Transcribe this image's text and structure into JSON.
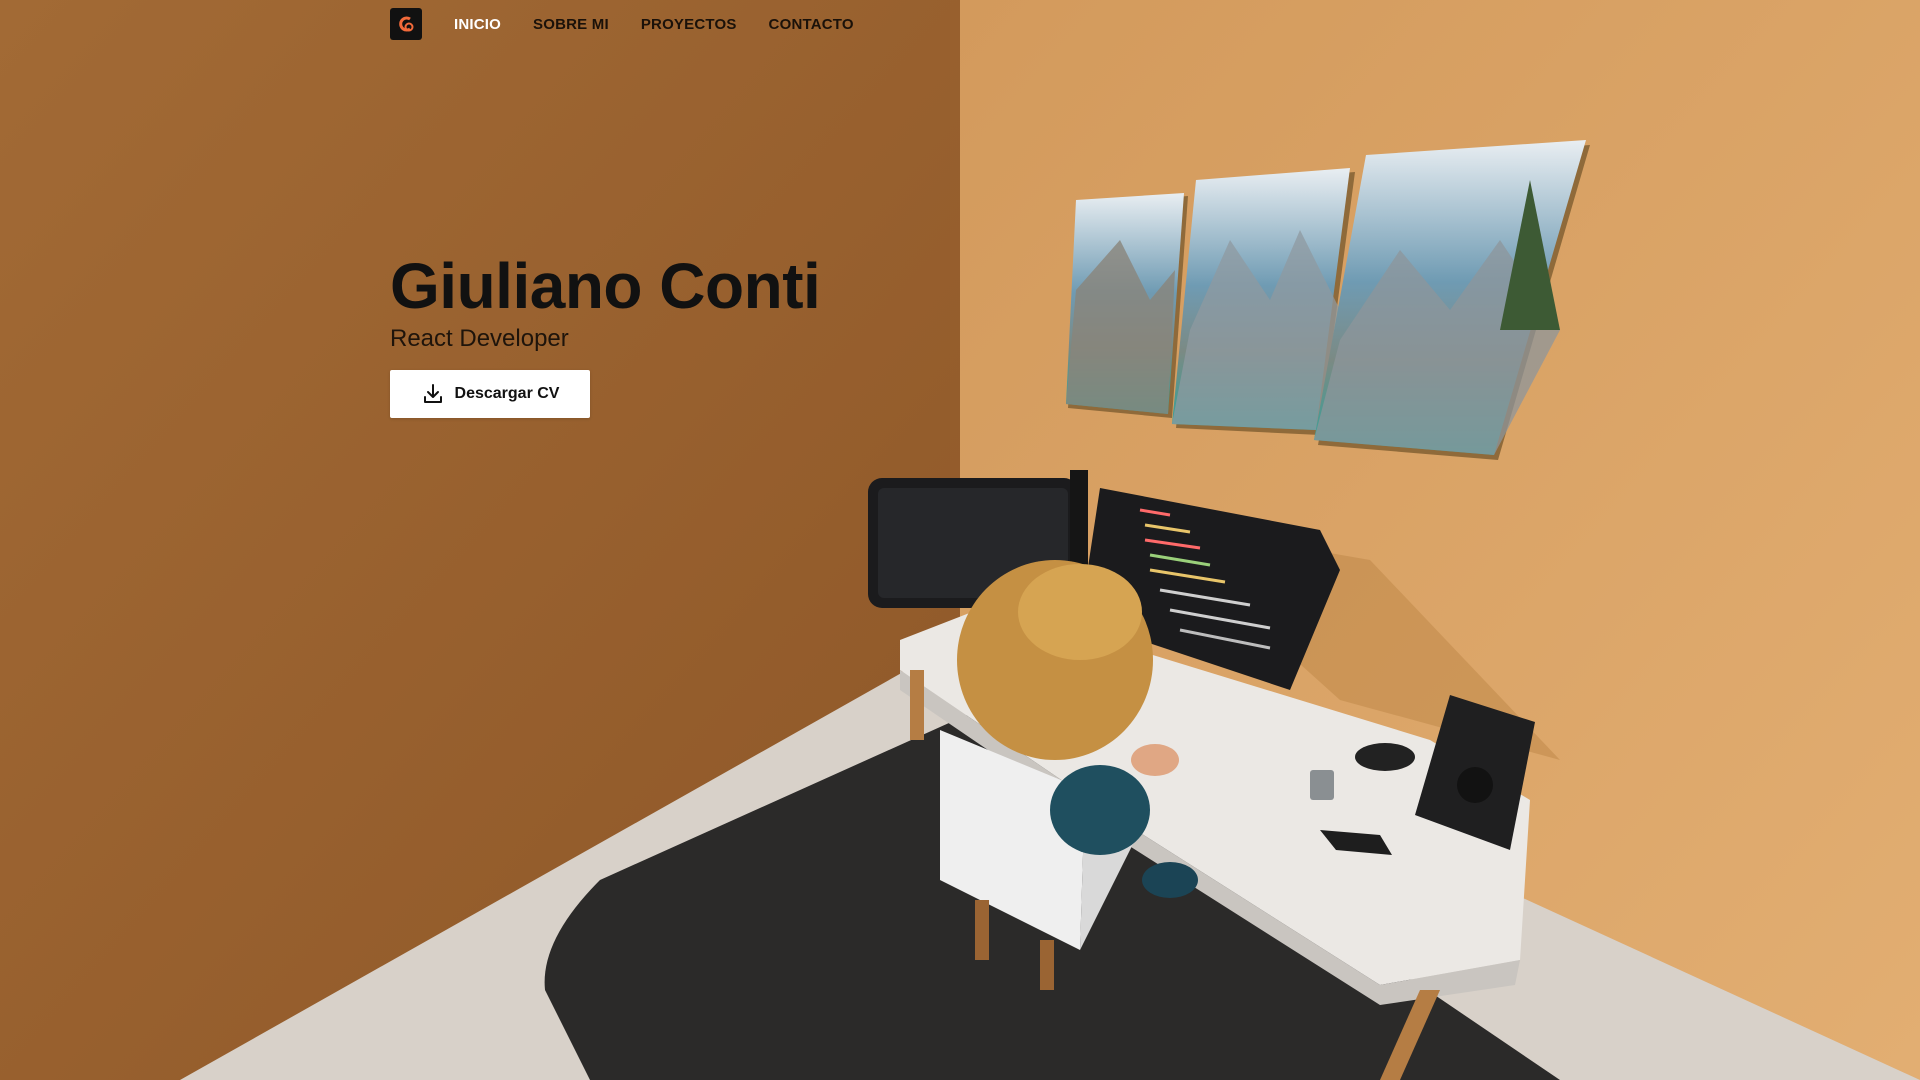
{
  "nav": {
    "logo_icon": "gc-logo-icon",
    "items": [
      {
        "label": "INICIO",
        "active": true
      },
      {
        "label": "SOBRE MI",
        "active": false
      },
      {
        "label": "PROYECTOS",
        "active": false
      },
      {
        "label": "CONTACTO",
        "active": false
      }
    ]
  },
  "hero": {
    "name": "Giuliano Conti",
    "role": "React Developer",
    "cv_button": {
      "label": "Descargar CV",
      "icon": "download-icon"
    }
  },
  "colors": {
    "left_wall": "#9b6230",
    "right_wall": "#d7a062",
    "floor": "#d6cfc7",
    "rug": "#2a2928",
    "desk": "#e9e6e2",
    "accent_active": "#ffffff"
  }
}
